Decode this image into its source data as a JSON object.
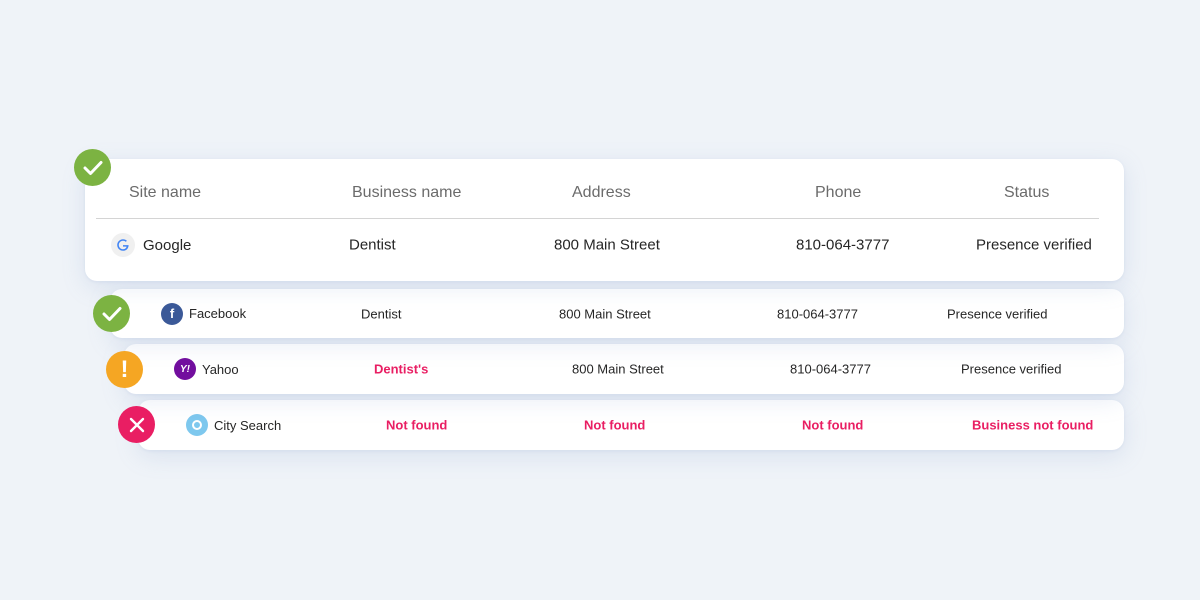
{
  "headers": {
    "site_name": "Site name",
    "business_name": "Business name",
    "address": "Address",
    "phone": "Phone",
    "status": "Status"
  },
  "rows": [
    {
      "site": "Google",
      "logo_icon": "google-icon",
      "business": "Dentist",
      "address": "800 Main Street",
      "phone": "810-064-3777",
      "status": "Presence verified",
      "badge": "check-icon",
      "badge_color": "#7cb342"
    },
    {
      "site": "Facebook",
      "logo_icon": "facebook-icon",
      "logo_glyph": "f",
      "business": "Dentist",
      "address": "800 Main Street",
      "phone": "810-064-3777",
      "status": "Presence verified",
      "badge": "check-icon",
      "badge_color": "#7cb342"
    },
    {
      "site": "Yahoo",
      "logo_icon": "yahoo-icon",
      "logo_glyph": "Y!",
      "business": "Dentist's",
      "address": "800 Main Street",
      "phone": "810-064-3777",
      "status": "Presence verified",
      "badge": "warning-icon",
      "badge_glyph": "!",
      "badge_color": "#f5a623"
    },
    {
      "site": "City Search",
      "logo_icon": "citysearch-icon",
      "business": "Not found",
      "address": "Not found",
      "phone": "Not found",
      "status": "Business not found",
      "badge": "error-x-icon",
      "badge_color": "#e91e63"
    }
  ],
  "colors": {
    "background": "#eff3f8",
    "success": "#7cb342",
    "warning": "#f5a623",
    "error": "#e91e63"
  }
}
